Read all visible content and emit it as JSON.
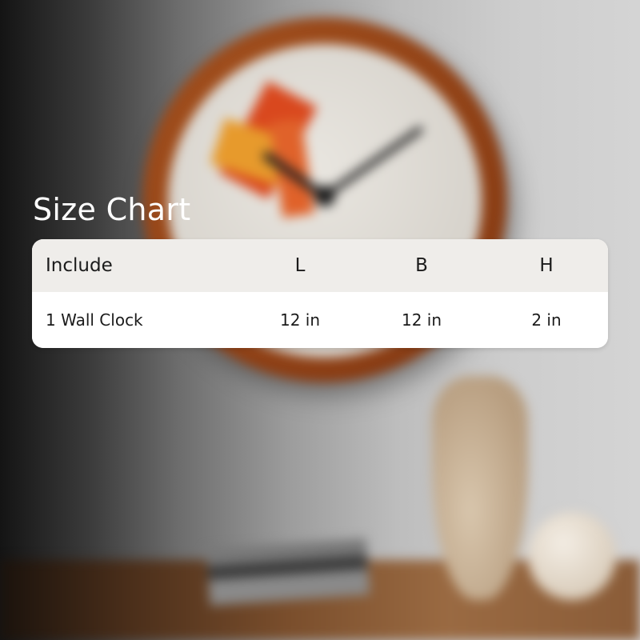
{
  "title": "Size Chart",
  "table": {
    "headers": [
      "Include",
      "L",
      "B",
      "H"
    ],
    "rows": [
      [
        "1 Wall Clock",
        "12 in",
        "12 in",
        "2 in"
      ]
    ]
  },
  "colors": {
    "title_text": "#ffffff",
    "header_background": "#efedea",
    "body_background": "#ffffff",
    "text": "#1b1b1b"
  }
}
